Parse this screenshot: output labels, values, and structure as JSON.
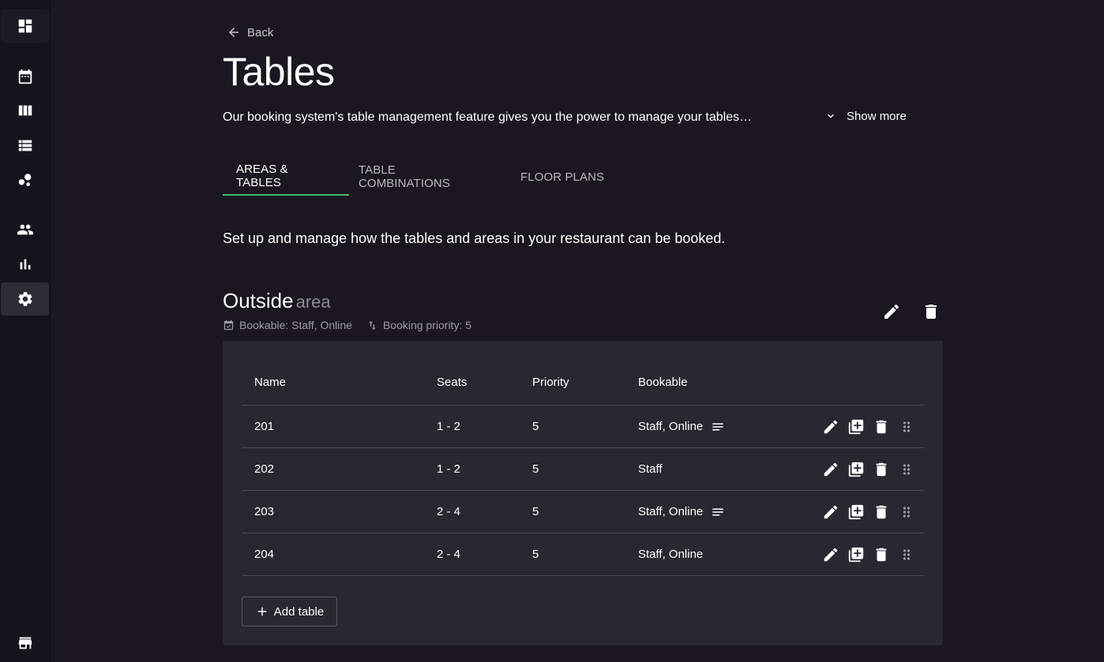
{
  "sidebar": {
    "items": [
      {
        "icon": "dashboard-icon"
      },
      {
        "icon": "calendar-icon"
      },
      {
        "icon": "columns-icon"
      },
      {
        "icon": "list-icon"
      },
      {
        "icon": "bubbles-icon"
      },
      {
        "icon": "people-icon"
      },
      {
        "icon": "bar-chart-icon"
      },
      {
        "icon": "gear-icon",
        "active": true
      },
      {
        "icon": "store-icon"
      }
    ]
  },
  "header": {
    "back_label": "Back",
    "title": "Tables",
    "description": "Our booking system's table management feature gives you the power to manage your tables…",
    "show_more_label": "Show more"
  },
  "tabs": [
    {
      "label": "AREAS & TABLES",
      "active": true
    },
    {
      "label": "TABLE COMBINATIONS",
      "active": false
    },
    {
      "label": "FLOOR PLANS",
      "active": false
    }
  ],
  "intro": "Set up and manage how the tables and areas in your restaurant can be booked.",
  "area": {
    "name": "Outside",
    "suffix": "area",
    "bookable": "Bookable: Staff, Online",
    "priority": "Booking priority: 5"
  },
  "table": {
    "columns": [
      "Name",
      "Seats",
      "Priority",
      "Bookable"
    ],
    "rows": [
      {
        "name": "201",
        "seats": "1 - 2",
        "priority": "5",
        "bookable": "Staff, Online",
        "has_notes": true
      },
      {
        "name": "202",
        "seats": "1 - 2",
        "priority": "5",
        "bookable": "Staff",
        "has_notes": false
      },
      {
        "name": "203",
        "seats": "2 - 4",
        "priority": "5",
        "bookable": "Staff, Online",
        "has_notes": true
      },
      {
        "name": "204",
        "seats": "2 - 4",
        "priority": "5",
        "bookable": "Staff, Online",
        "has_notes": false
      }
    ]
  },
  "add_table_label": "Add table",
  "colors": {
    "background": "#1a1720",
    "card": "#29272f",
    "accent": "#3fb874"
  }
}
